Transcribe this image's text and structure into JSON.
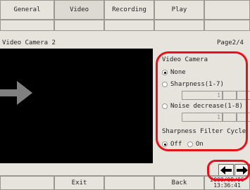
{
  "tabs": [
    {
      "label": "General",
      "active": false
    },
    {
      "label": "Video",
      "active": true
    },
    {
      "label": "Recording",
      "active": false
    },
    {
      "label": "Play",
      "active": false
    }
  ],
  "panel": {
    "title": "Video Camera 2",
    "page": "Page2/4"
  },
  "settings": {
    "section_title": "Video Camera",
    "options": {
      "none": "None",
      "sharpness": "Sharpness(1-7)",
      "sharpness_value": "1",
      "noise": "Noise decrease(1-8)",
      "noise_value": "1"
    },
    "selected": "None",
    "filter_cycle": {
      "title": "Sharpness Filter Cycle",
      "off": "Off",
      "on": "On",
      "selected": "Off"
    }
  },
  "nav": {
    "prev_icon": "left-arrow-icon",
    "next_icon": "right-arrow-icon"
  },
  "bottom": {
    "exit": "Exit",
    "back": "Back",
    "date": "2009/08/06",
    "time": "13:36:41"
  },
  "colors": {
    "annotation": "#e5111b",
    "arrow": "#808080"
  }
}
